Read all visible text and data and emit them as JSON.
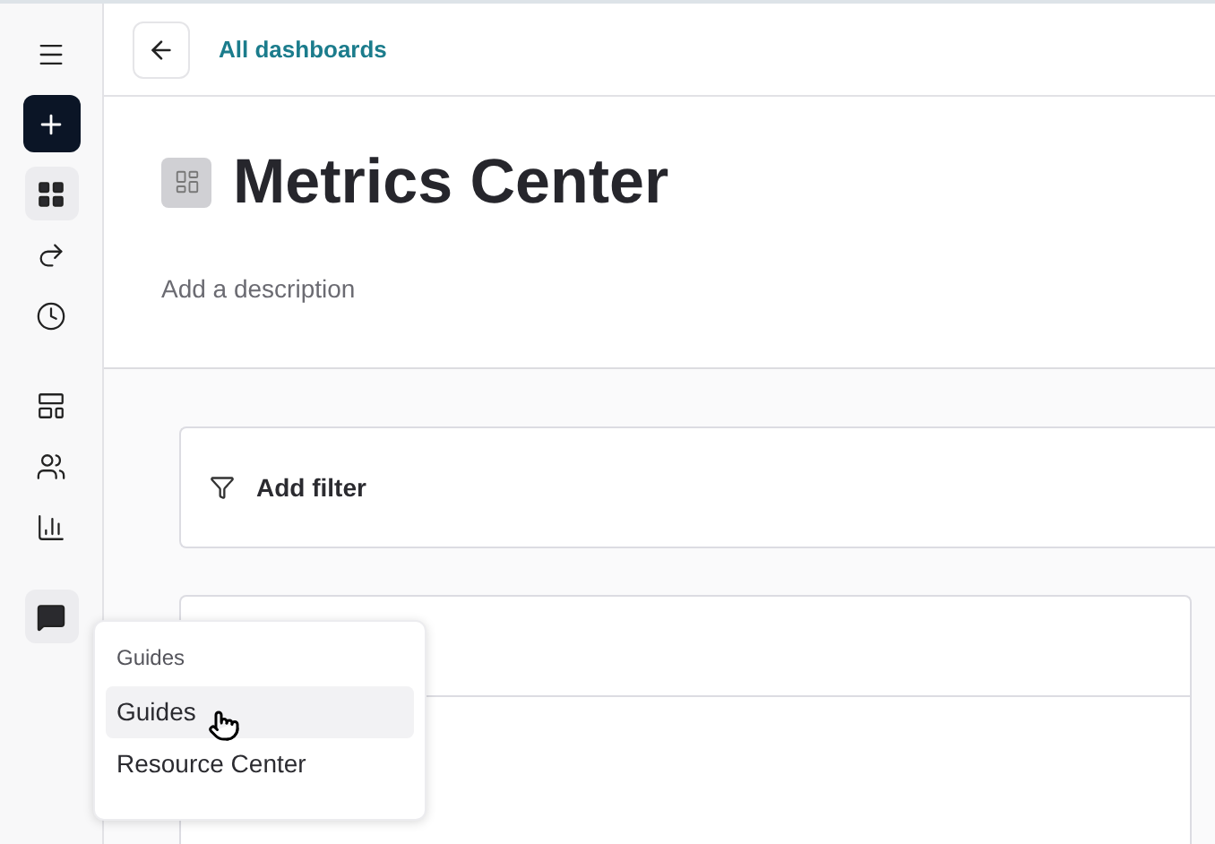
{
  "sidebar": {
    "groups": [
      {
        "items": [
          {
            "kind": "menu",
            "selected": false
          },
          {
            "kind": "new",
            "selected": false
          },
          {
            "kind": "dashboards",
            "selected": true
          },
          {
            "kind": "redo",
            "selected": false
          },
          {
            "kind": "history",
            "selected": false
          }
        ]
      },
      {
        "items": [
          {
            "kind": "layout",
            "selected": false
          },
          {
            "kind": "users",
            "selected": false
          },
          {
            "kind": "chart",
            "selected": false
          }
        ]
      },
      {
        "items": [
          {
            "kind": "chat",
            "selected": true
          }
        ]
      }
    ]
  },
  "header": {
    "back_link": "All dashboards"
  },
  "dashboard": {
    "title": "Metrics Center",
    "description_placeholder": "Add a description"
  },
  "filter_bar": {
    "label": "Add filter"
  },
  "guides_menu": {
    "heading": "Guides",
    "items": [
      {
        "label": "Guides",
        "selected": true
      },
      {
        "label": "Resource Center",
        "selected": false
      }
    ]
  }
}
